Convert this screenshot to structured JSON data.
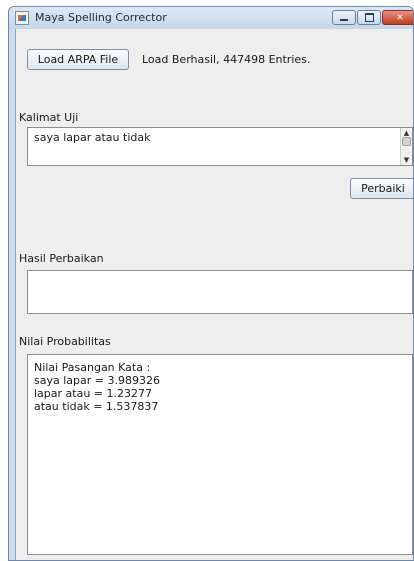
{
  "window": {
    "title": "Maya Spelling Corrector"
  },
  "toolbar": {
    "load_button_label": "Load ARPA File",
    "load_status": "Load Berhasil, 447498 Entries."
  },
  "kalimat_uji": {
    "label": "Kalimat Uji",
    "value": "saya lapar atau tidak"
  },
  "perbaiki_button_label": "Perbaiki",
  "hasil_perbaikan": {
    "label": "Hasil Perbaikan",
    "value": ""
  },
  "nilai_probabilitas": {
    "label": "Nilai Probabilitas",
    "lines": [
      "Nilai Pasangan Kata :",
      "saya lapar = 3.989326",
      "lapar atau = 1.23277",
      "atau tidak = 1.537837"
    ]
  }
}
